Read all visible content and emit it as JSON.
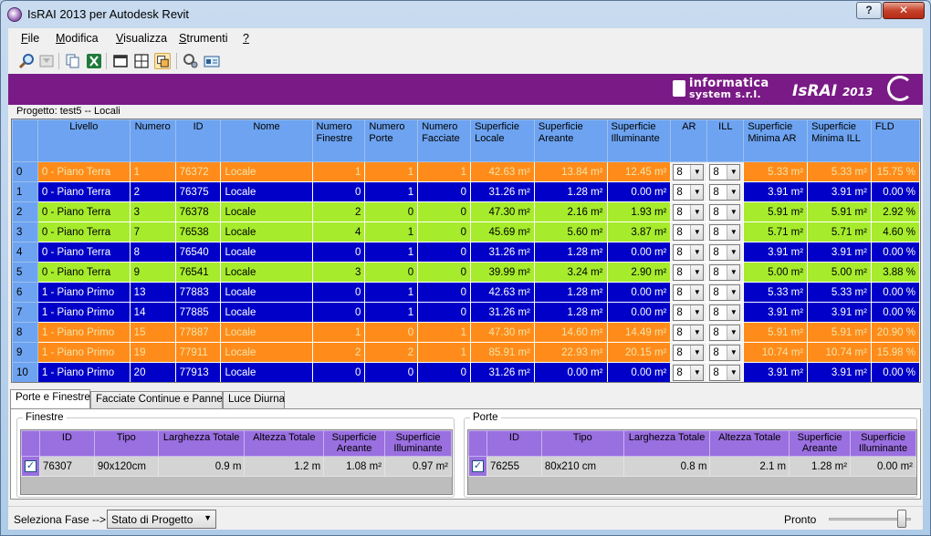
{
  "window": {
    "title": "IsRAI 2013 per Autodesk Revit",
    "help_btn": "?",
    "close_btn": "✕"
  },
  "menu": [
    "File",
    "Modifica",
    "Visualizza",
    "Strumenti",
    "?"
  ],
  "toolbar_icons": [
    "zoom-icon",
    "filter-icon",
    "copy-icon",
    "excel-icon",
    "view-single-icon",
    "view-grid-icon",
    "view-tiles-icon",
    "search-settings-icon",
    "info-card-icon"
  ],
  "banner": {
    "logo_line1": "informatica",
    "logo_line2": "system s.r.l.",
    "product": "IsRAI",
    "year": "2013"
  },
  "project_label": "Progetto: test5  -- Locali",
  "grid": {
    "headers": [
      "",
      "Livello",
      "Numero",
      "ID",
      "Nome",
      "Numero Finestre",
      "Numero Porte",
      "Numero Facciate",
      "Superficie Locale",
      "Superficie Areante",
      "Superficie Illuminante",
      "AR",
      "ILL",
      "Superficie Minima AR",
      "Superficie Minima ILL",
      "FLD"
    ],
    "rows": [
      {
        "idx": "0",
        "color": "orange",
        "livello": "0 - Piano Terra",
        "numero": "1",
        "id": "76372",
        "nome": "Locale",
        "finestre": "1",
        "porte": "1",
        "facciate": "1",
        "sup_locale": "42.63 m²",
        "sup_areante": "13.84 m²",
        "sup_illum": "12.45 m²",
        "ar": "8",
        "ill": "8",
        "min_ar": "5.33 m²",
        "min_ill": "5.33 m²",
        "fld": "15.75 %"
      },
      {
        "idx": "1",
        "color": "blue",
        "livello": "0 - Piano Terra",
        "numero": "2",
        "id": "76375",
        "nome": "Locale",
        "finestre": "0",
        "porte": "1",
        "facciate": "0",
        "sup_locale": "31.26 m²",
        "sup_areante": "1.28 m²",
        "sup_illum": "0.00 m²",
        "ar": "8",
        "ill": "8",
        "min_ar": "3.91 m²",
        "min_ill": "3.91 m²",
        "fld": "0.00 %"
      },
      {
        "idx": "2",
        "color": "green",
        "livello": "0 - Piano Terra",
        "numero": "3",
        "id": "76378",
        "nome": "Locale",
        "finestre": "2",
        "porte": "0",
        "facciate": "0",
        "sup_locale": "47.30 m²",
        "sup_areante": "2.16 m²",
        "sup_illum": "1.93 m²",
        "ar": "8",
        "ill": "8",
        "min_ar": "5.91 m²",
        "min_ill": "5.91 m²",
        "fld": "2.92 %"
      },
      {
        "idx": "3",
        "color": "green",
        "livello": "0 - Piano Terra",
        "numero": "7",
        "id": "76538",
        "nome": "Locale",
        "finestre": "4",
        "porte": "1",
        "facciate": "0",
        "sup_locale": "45.69 m²",
        "sup_areante": "5.60 m²",
        "sup_illum": "3.87 m²",
        "ar": "8",
        "ill": "8",
        "min_ar": "5.71 m²",
        "min_ill": "5.71 m²",
        "fld": "4.60 %"
      },
      {
        "idx": "4",
        "color": "blue",
        "livello": "0 - Piano Terra",
        "numero": "8",
        "id": "76540",
        "nome": "Locale",
        "finestre": "0",
        "porte": "1",
        "facciate": "0",
        "sup_locale": "31.26 m²",
        "sup_areante": "1.28 m²",
        "sup_illum": "0.00 m²",
        "ar": "8",
        "ill": "8",
        "min_ar": "3.91 m²",
        "min_ill": "3.91 m²",
        "fld": "0.00 %"
      },
      {
        "idx": "5",
        "color": "green",
        "livello": "0 - Piano Terra",
        "numero": "9",
        "id": "76541",
        "nome": "Locale",
        "finestre": "3",
        "porte": "0",
        "facciate": "0",
        "sup_locale": "39.99 m²",
        "sup_areante": "3.24 m²",
        "sup_illum": "2.90 m²",
        "ar": "8",
        "ill": "8",
        "min_ar": "5.00 m²",
        "min_ill": "5.00 m²",
        "fld": "3.88 %"
      },
      {
        "idx": "6",
        "color": "blue",
        "livello": "1 - Piano Primo",
        "numero": "13",
        "id": "77883",
        "nome": "Locale",
        "finestre": "0",
        "porte": "1",
        "facciate": "0",
        "sup_locale": "42.63 m²",
        "sup_areante": "1.28 m²",
        "sup_illum": "0.00 m²",
        "ar": "8",
        "ill": "8",
        "min_ar": "5.33 m²",
        "min_ill": "5.33 m²",
        "fld": "0.00 %"
      },
      {
        "idx": "7",
        "color": "blue",
        "livello": "1 - Piano Primo",
        "numero": "14",
        "id": "77885",
        "nome": "Locale",
        "finestre": "0",
        "porte": "1",
        "facciate": "0",
        "sup_locale": "31.26 m²",
        "sup_areante": "1.28 m²",
        "sup_illum": "0.00 m²",
        "ar": "8",
        "ill": "8",
        "min_ar": "3.91 m²",
        "min_ill": "3.91 m²",
        "fld": "0.00 %"
      },
      {
        "idx": "8",
        "color": "orange",
        "livello": "1 - Piano Primo",
        "numero": "15",
        "id": "77887",
        "nome": "Locale",
        "finestre": "1",
        "porte": "0",
        "facciate": "1",
        "sup_locale": "47.30 m²",
        "sup_areante": "14.60 m²",
        "sup_illum": "14.49 m²",
        "ar": "8",
        "ill": "8",
        "min_ar": "5.91 m²",
        "min_ill": "5.91 m²",
        "fld": "20.90 %"
      },
      {
        "idx": "9",
        "color": "orange",
        "livello": "1 - Piano Primo",
        "numero": "19",
        "id": "77911",
        "nome": "Locale",
        "finestre": "2",
        "porte": "2",
        "facciate": "1",
        "sup_locale": "85.91 m²",
        "sup_areante": "22.93 m²",
        "sup_illum": "20.15 m²",
        "ar": "8",
        "ill": "8",
        "min_ar": "10.74 m²",
        "min_ill": "10.74 m²",
        "fld": "15.98 %"
      },
      {
        "idx": "10",
        "color": "blue",
        "livello": "1 - Piano Primo",
        "numero": "20",
        "id": "77913",
        "nome": "Locale",
        "finestre": "0",
        "porte": "0",
        "facciate": "0",
        "sup_locale": "31.26 m²",
        "sup_areante": "0.00 m²",
        "sup_illum": "0.00 m²",
        "ar": "8",
        "ill": "8",
        "min_ar": "3.91 m²",
        "min_ill": "3.91 m²",
        "fld": "0.00 %"
      }
    ]
  },
  "tabs": [
    "Porte e Finestre",
    "Facciate Continue e Pannelli",
    "Luce Diurna"
  ],
  "finestre": {
    "title": "Finestre",
    "headers": [
      "",
      "ID",
      "Tipo",
      "Larghezza Totale",
      "Altezza Totale",
      "Superficie Areante",
      "Superficie Illuminante"
    ],
    "rows": [
      {
        "checked": "✓",
        "id": "76307",
        "tipo": "90x120cm",
        "larghezza": "0.9 m",
        "altezza": "1.2 m",
        "areante": "1.08 m²",
        "illuminante": "0.97 m²"
      }
    ]
  },
  "porte": {
    "title": "Porte",
    "headers": [
      "",
      "ID",
      "Tipo",
      "Larghezza Totale",
      "Altezza Totale",
      "Superficie Areante",
      "Superficie Illuminante"
    ],
    "rows": [
      {
        "checked": "✓",
        "id": "76255",
        "tipo": "80x210 cm",
        "larghezza": "0.8 m",
        "altezza": "2.1 m",
        "areante": "1.28 m²",
        "illuminante": "0.00 m²"
      }
    ]
  },
  "status": {
    "phase_label": "Seleziona Fase -->",
    "phase_value": "Stato di Progetto",
    "state": "Pronto",
    "zoom_level": 1.0
  },
  "colors": {
    "orange": "#ff8c1a",
    "blue": "#0000c8",
    "green": "#a6ec2c",
    "header": "#6da3f0",
    "banner": "#7a1a86",
    "subheader": "#9a6fe0"
  }
}
